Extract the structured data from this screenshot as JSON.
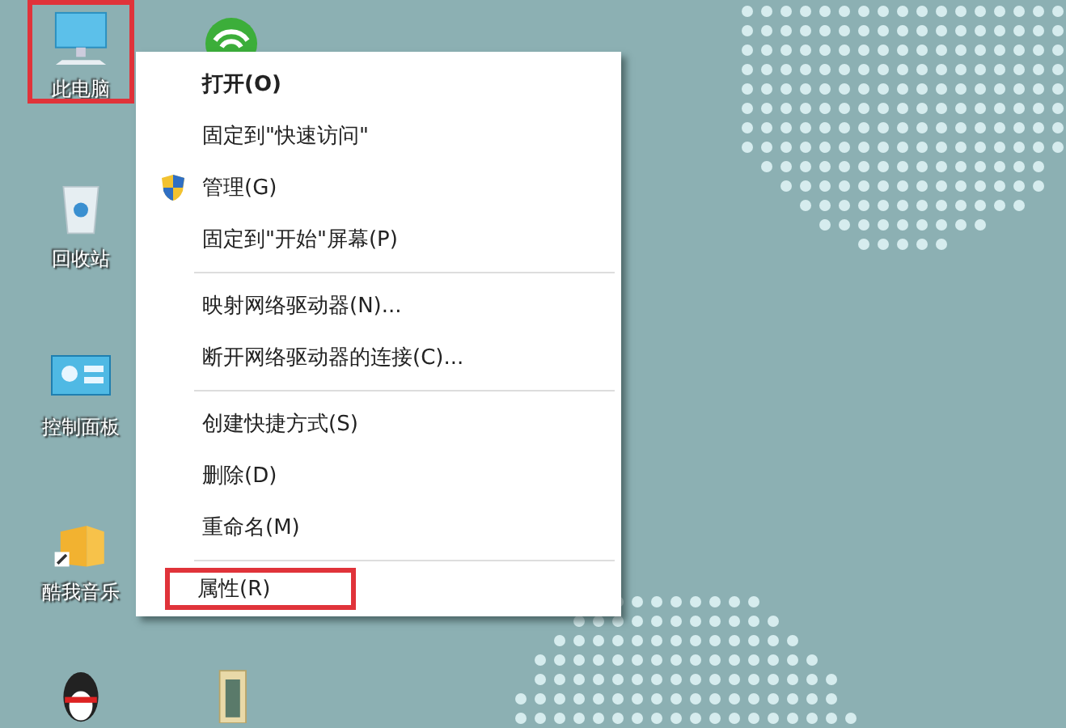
{
  "desktop": {
    "icons": [
      {
        "kind": "computer",
        "label": "此电脑",
        "highlighted": true
      },
      {
        "kind": "recycle-bin",
        "label": "回收站",
        "highlighted": false
      },
      {
        "kind": "control-panel",
        "label": "控制面板",
        "highlighted": false
      },
      {
        "kind": "music",
        "label": "酷我音乐",
        "highlighted": false
      },
      {
        "kind": "penguin",
        "highlighted": false
      },
      {
        "kind": "wifi",
        "highlighted": false
      },
      {
        "kind": "book",
        "highlighted": false
      }
    ]
  },
  "context_menu": {
    "groups": [
      [
        {
          "label": "打开(O)",
          "bold": true,
          "highlighted": false
        },
        {
          "label": "固定到\"快速访问\"",
          "bold": false,
          "highlighted": false
        },
        {
          "label": "管理(G)",
          "kind": "shield",
          "bold": false,
          "highlighted": false
        },
        {
          "label": "固定到\"开始\"屏幕(P)",
          "bold": false,
          "highlighted": false
        }
      ],
      [
        {
          "label": "映射网络驱动器(N)...",
          "bold": false,
          "highlighted": false
        },
        {
          "label": "断开网络驱动器的连接(C)...",
          "bold": false,
          "highlighted": false
        }
      ],
      [
        {
          "label": "创建快捷方式(S)",
          "bold": false,
          "highlighted": false
        },
        {
          "label": "删除(D)",
          "bold": false,
          "highlighted": false
        },
        {
          "label": "重命名(M)",
          "bold": false,
          "highlighted": false
        }
      ],
      [
        {
          "label": "属性(R)",
          "bold": false,
          "highlighted": true
        }
      ]
    ]
  }
}
